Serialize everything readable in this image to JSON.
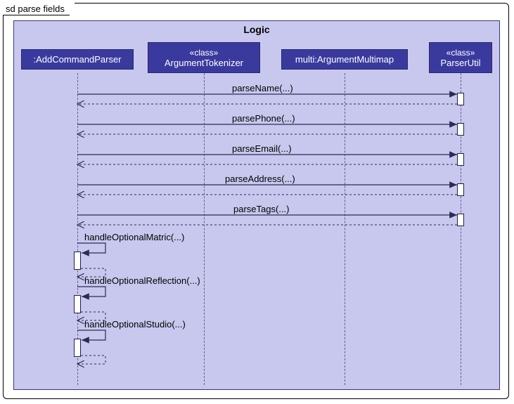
{
  "frame_label": "sd parse fields",
  "logic_title": "Logic",
  "participants": {
    "p1": ":AddCommandParser",
    "p2_stereo": "«class»",
    "p2_name": "ArgumentTokenizer",
    "p3": "multi:ArgumentMultimap",
    "p4_stereo": "«class»",
    "p4_name": "ParserUtil"
  },
  "messages": {
    "m1": "parseName(...)",
    "m2": "parsePhone(...)",
    "m3": "parseEmail(...)",
    "m4": "parseAddress(...)",
    "m5": "parseTags(...)",
    "m6": "handleOptionalMatric(...)",
    "m7": "handleOptionalReflection(...)",
    "m8": "handleOptionalStudio(...)"
  }
}
